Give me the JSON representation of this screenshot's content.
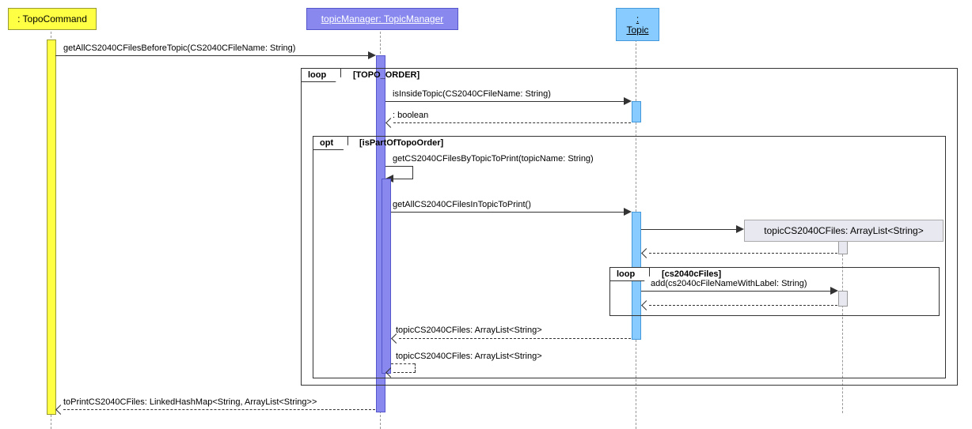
{
  "lifelines": {
    "topoCommand": ": TopoCommand",
    "topicManager": "topicManager: TopicManager",
    "topic": ": Topic",
    "arrayList": "topicCS2040CFiles: ArrayList<String>"
  },
  "messages": {
    "msg1": "getAllCS2040CFilesBeforeTopic(CS2040CFileName: String)",
    "msg2": "isInsideTopic(CS2040CFileName: String)",
    "msg3": ": boolean",
    "msg4": "getCS2040CFilesByTopicToPrint(topicName: String)",
    "msg5": "getAllCS2040CFilesInTopicToPrint()",
    "msg6": "add(cs2040cFileNameWithLabel: String)",
    "msg7": "topicCS2040CFiles: ArrayList<String>",
    "msg8": "topicCS2040CFiles: ArrayList<String>",
    "msg9": "toPrintCS2040CFiles: LinkedHashMap<String, ArrayList<String>>"
  },
  "fragments": {
    "loop1": {
      "label": "loop",
      "guard": "[TOPO_ORDER]"
    },
    "opt1": {
      "label": "opt",
      "guard": "[isPartOfTopoOrder]"
    },
    "loop2": {
      "label": "loop",
      "guard": "[cs2040cFiles]"
    }
  }
}
